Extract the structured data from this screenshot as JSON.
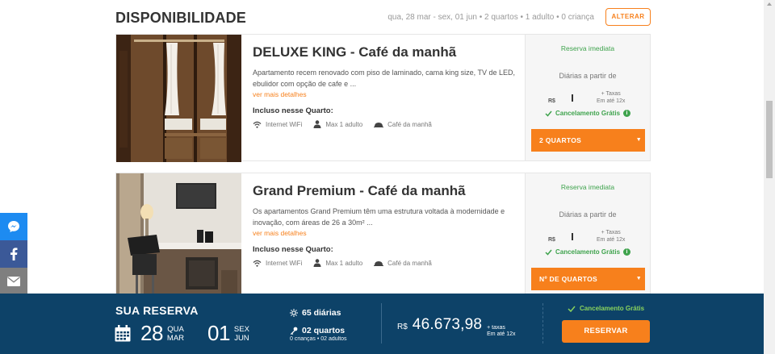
{
  "availability": {
    "title": "DISPONIBILIDADE",
    "summary": "qua, 28 mar - sex, 01 jun • 2 quartos • 1 adulto • 0 criança",
    "alter_label": "ALTERAR"
  },
  "rooms": [
    {
      "name": "DELUXE KING - Café da manhã",
      "description": "Apartamento recem renovado com piso de laminado, cama king size, TV de LED, ebulidor com opção de cafe e ...",
      "more_label": "ver mais detalhes",
      "included_title": "Incluso nesse Quarto:",
      "amenities": [
        "Internet WiFi",
        "Max 1 adulto",
        "Café da manhã"
      ],
      "immediate": "Reserva imediata",
      "price_from": "Diárias a partir de",
      "currency": "R$",
      "taxes": "+ Taxas",
      "installments": "Em até 12x",
      "cancellation": "Cancelamento Grátis",
      "select_label": "2 QUARTOS"
    },
    {
      "name": "Grand Premium - Café da manhã",
      "description": "Os apartamentos Grand Premium têm uma estrutura voltada à modernidade e inovação, com áreas de 26 a 30m² ...",
      "more_label": "ver mais detalhes",
      "included_title": "Incluso nesse Quarto:",
      "amenities": [
        "Internet WiFi",
        "Max 1 adulto",
        "Café da manhã"
      ],
      "immediate": "Reserva imediata",
      "price_from": "Diárias a partir de",
      "currency": "R$",
      "taxes": "+ Taxas",
      "installments": "Em até 12x",
      "cancellation": "Cancelamento Grátis",
      "select_label": "Nº DE QUARTOS"
    }
  ],
  "social": [
    "messenger-icon",
    "facebook-icon",
    "email-icon",
    "pinterest-icon",
    "twitter-icon"
  ],
  "reservation": {
    "title": "SUA RESERVA",
    "checkin": {
      "day": "28",
      "weekday": "QUA",
      "month": "MAR"
    },
    "checkout": {
      "day": "01",
      "weekday": "SEX",
      "month": "JUN"
    },
    "nights": "65 diárias",
    "rooms": "02 quartos",
    "guests": "0 crianças • 02 adultos",
    "currency": "R$",
    "total": "46.673,98",
    "taxes": "+ taxas",
    "installments": "Em até 12x",
    "cancellation": "Cancelamento Grátis",
    "reserve_label": "RESERVAR"
  },
  "colors": {
    "accent": "#f7801c",
    "bar": "#0d4268",
    "green": "#3fa34d"
  }
}
